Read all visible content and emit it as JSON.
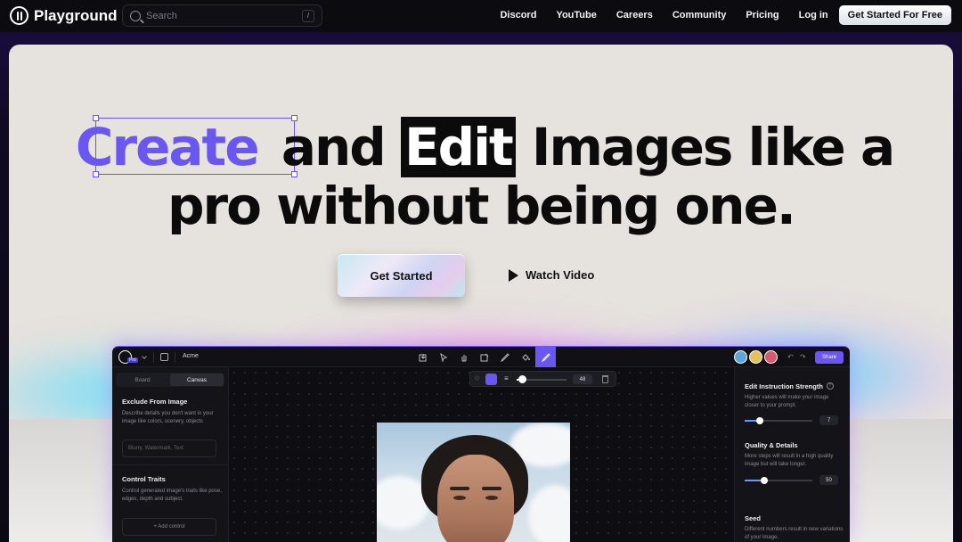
{
  "nav": {
    "brand": "Playground",
    "search_placeholder": "Search",
    "search_shortcut": "/",
    "links": [
      "Discord",
      "YouTube",
      "Careers",
      "Community",
      "Pricing",
      "Log in"
    ],
    "cta": "Get Started For Free"
  },
  "hero": {
    "word_create": "Create",
    "word_and": " and ",
    "word_edit": "Edit",
    "line1_rest": " Images like a",
    "line2": "pro without being one.",
    "primary_button": "Get Started",
    "secondary_button": "Watch Video",
    "accent_color": "#6a56f0"
  },
  "app": {
    "pro_badge": "Pro",
    "project_name": "Acme",
    "share": "Share",
    "tabs": [
      "Board",
      "Canvas"
    ],
    "active_tab": "Canvas",
    "brush_size": "48",
    "brush_fraction": 0.1,
    "left_panel": {
      "exclude_title": "Exclude From Image",
      "exclude_desc": "Describe details you don't want in your image like colors, scenery, objects",
      "exclude_placeholder": "Blurry, Watermark, Text",
      "control_title": "Control Traits",
      "control_desc": "Control generated image's traits like pose, edges, depth and subject.",
      "add_control": "+ Add control"
    },
    "right_panel": {
      "strength_title": "Edit Instruction Strength",
      "strength_desc": "Higher values will make your image closer to your prompt.",
      "strength_value": "7",
      "strength_fraction": 0.23,
      "quality_title": "Quality & Details",
      "quality_desc": "More steps will result in a high quality image but will take longer.",
      "quality_value": "50",
      "quality_fraction": 0.29,
      "seed_title": "Seed",
      "seed_desc": "Different numbers result in new variations of your image."
    }
  }
}
